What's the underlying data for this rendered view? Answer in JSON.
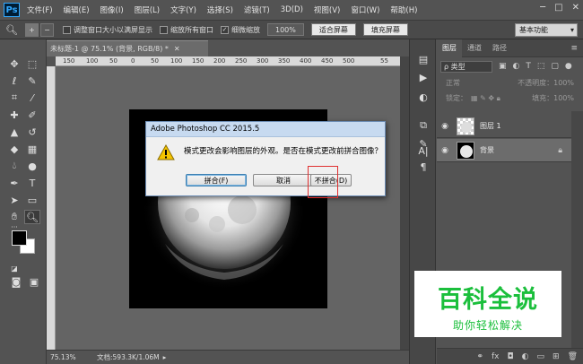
{
  "menu": [
    "文件(F)",
    "编辑(E)",
    "图像(I)",
    "图层(L)",
    "文字(Y)",
    "选择(S)",
    "滤镜(T)",
    "3D(D)",
    "视图(V)",
    "窗口(W)",
    "帮助(H)"
  ],
  "app_logo": "Ps",
  "options": {
    "resize_windows": "调整窗口大小以满屏显示",
    "zoom_all_windows": "缩放所有窗口",
    "scrubby_zoom": "细微缩放",
    "zoom_value": "100%",
    "fit_screen": "适合屏幕",
    "fill_screen": "填充屏幕",
    "workspace": "基本功能"
  },
  "document": {
    "tab_title": "未标题-1 @ 75.1% (背景, RGB/8) *",
    "ruler_ticks": [
      "150",
      "100",
      "50",
      "0",
      "50",
      "100",
      "150",
      "200",
      "250",
      "300",
      "350",
      "400",
      "450",
      "500",
      "55"
    ],
    "zoom_level": "75.13%",
    "doc_info": "文档:593.3K/1.06M"
  },
  "dialog": {
    "title": "Adobe Photoshop CC 2015.5",
    "message": "模式更改会影响图层的外观。是否在模式更改前拼合图像？",
    "flatten_button": "拼合(F)",
    "cancel_button": "取消",
    "dont_flatten_button": "不拼合(D)"
  },
  "layers_panel": {
    "tabs": [
      "图层",
      "通道",
      "路径"
    ],
    "filter_type": "ρ 类型",
    "blend_mode": "正常",
    "opacity_label": "不透明度：100%",
    "lock_label": "锁定：",
    "fill_label": "填充：100%",
    "layers": [
      {
        "name": "图层 1",
        "selected": false,
        "locked": false
      },
      {
        "name": "背景",
        "selected": true,
        "locked": true
      }
    ],
    "footer_fx": "fx"
  },
  "watermark": {
    "title": "百科全说",
    "subtitle": "助你轻松解决"
  },
  "colors": {
    "foreground": "#000000",
    "background": "#ffffff",
    "watermark_green": "#1bbf3c",
    "highlight_red": "#e03030"
  }
}
